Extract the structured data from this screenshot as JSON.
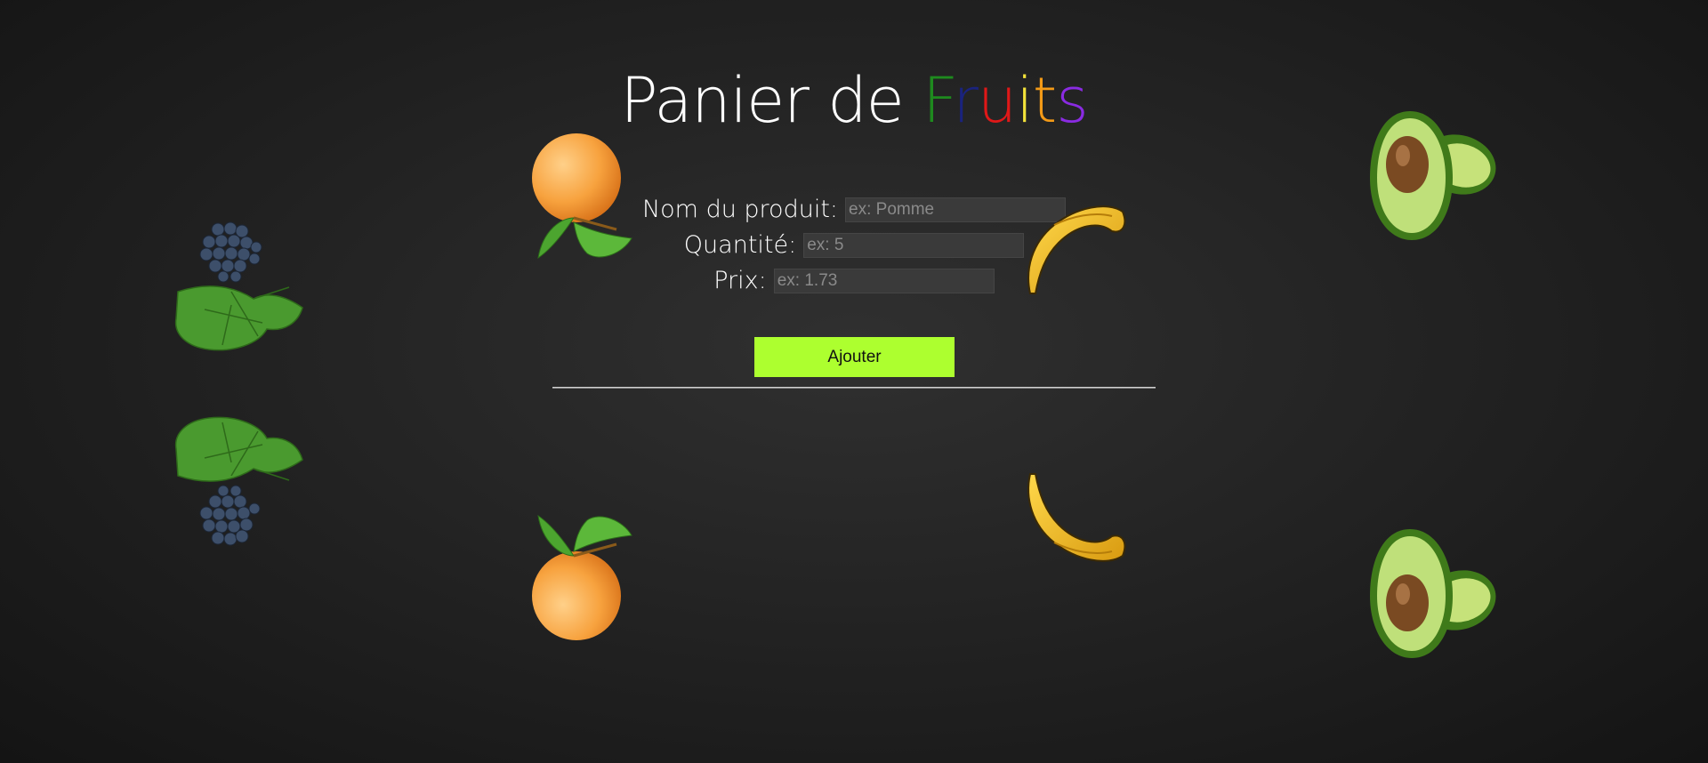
{
  "title": {
    "prefix": "Panier de ",
    "letters": [
      {
        "char": "F",
        "color": "#1e8a1e"
      },
      {
        "char": "r",
        "color": "#1a237e"
      },
      {
        "char": "u",
        "color": "#e01818"
      },
      {
        "char": "i",
        "color": "#f3e23a"
      },
      {
        "char": "t",
        "color": "#f39a17"
      },
      {
        "char": "s",
        "color": "#8a2be2"
      }
    ]
  },
  "form": {
    "name_label": "Nom du produit:",
    "name_placeholder": "ex: Pomme",
    "qty_label": "Quantité:",
    "qty_placeholder": "ex: 5",
    "price_label": "Prix:",
    "price_placeholder": "ex: 1.73",
    "submit_label": "Ajouter",
    "submit_color": "#adff2f"
  },
  "decorations": [
    "grapes-icon",
    "apricot-icon",
    "banana-icon",
    "avocado-icon"
  ]
}
